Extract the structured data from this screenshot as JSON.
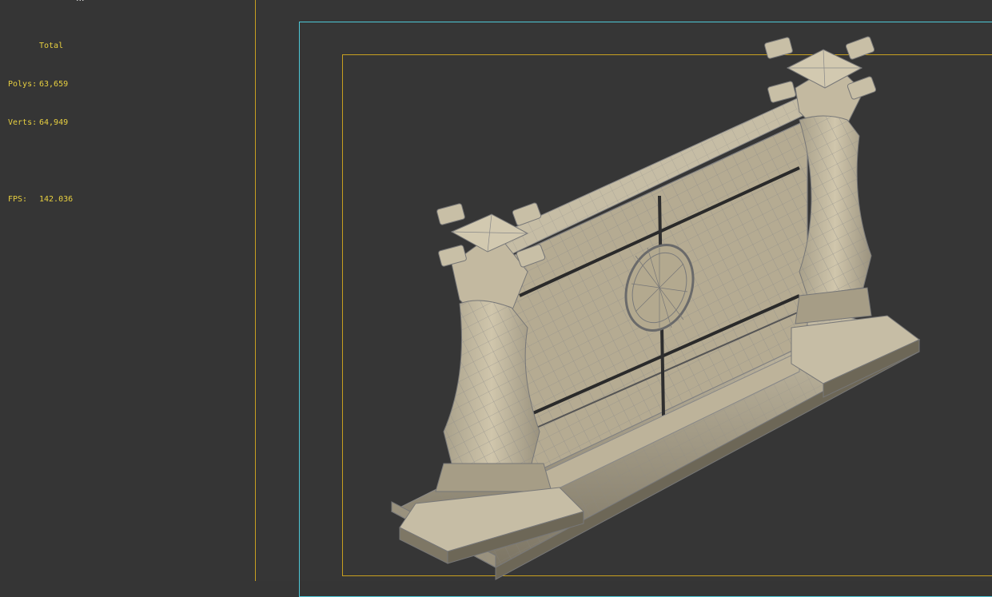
{
  "viewport_title": "...",
  "stats": {
    "header": "Total",
    "polys_label": "Polys:",
    "polys_value": "63,659",
    "verts_label": "Verts:",
    "verts_value": "64,949",
    "fps_label": "FPS:",
    "fps_value": "142.036"
  },
  "colors": {
    "background": "#353535",
    "stats_text": "#e8d040",
    "safe_frame_cyan": "#4ec8d8",
    "safe_frame_yellow": "#c8a020",
    "model_fill": "#b8ad92",
    "wire": "#7a7a7a"
  }
}
